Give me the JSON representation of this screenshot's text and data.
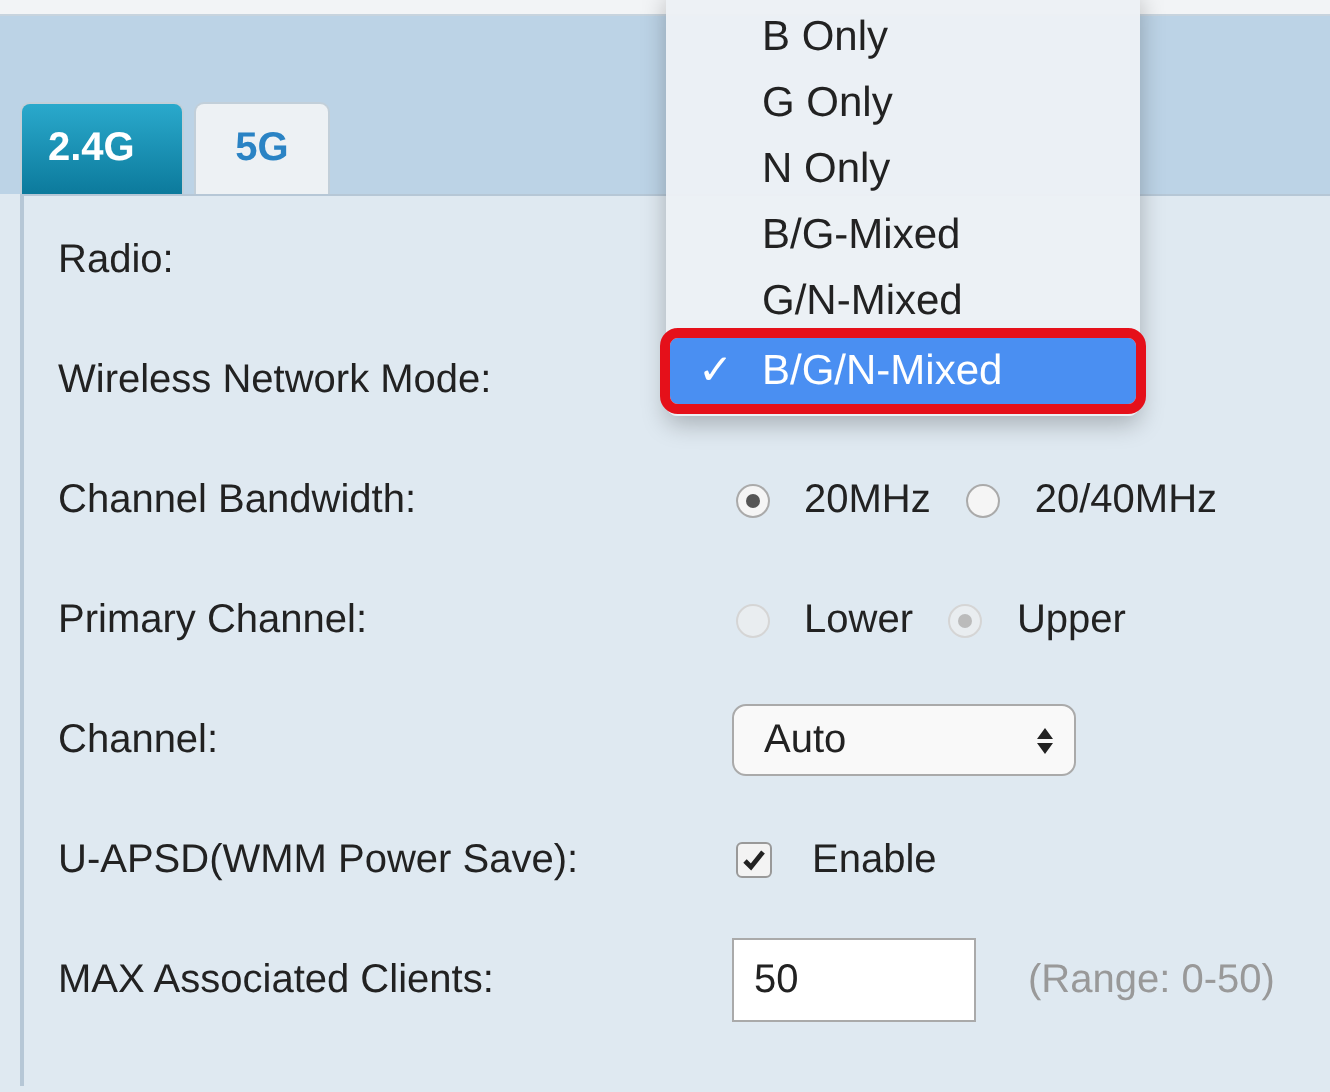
{
  "tabs": [
    {
      "label": "2.4G",
      "selected": true
    },
    {
      "label": "5G",
      "selected": false
    }
  ],
  "form": {
    "rows": [
      {
        "label": "Radio:",
        "kind": "label"
      },
      {
        "label": "Wireless Network Mode:",
        "kind": "label"
      },
      {
        "label": "Channel Bandwidth:",
        "kind": "radio",
        "disabled": false,
        "options": [
          {
            "label": "20MHz",
            "selected": true
          },
          {
            "label": "20/40MHz",
            "selected": false
          }
        ]
      },
      {
        "label": "Primary Channel:",
        "kind": "radio",
        "disabled": true,
        "options": [
          {
            "label": "Lower",
            "selected": false
          },
          {
            "label": "Upper",
            "selected": true
          }
        ]
      },
      {
        "label": "Channel:",
        "kind": "select",
        "value": "Auto"
      },
      {
        "label": "U-APSD(WMM Power Save):",
        "kind": "checkbox",
        "checked": true,
        "text": "Enable"
      },
      {
        "label": "MAX Associated Clients:",
        "kind": "input",
        "value": "50",
        "hint": "(Range: 0-50)"
      }
    ]
  },
  "dropdown": {
    "check": "✓",
    "items": [
      {
        "label": "B Only",
        "selected": false
      },
      {
        "label": "G Only",
        "selected": false
      },
      {
        "label": "N Only",
        "selected": false
      },
      {
        "label": "B/G-Mixed",
        "selected": false
      },
      {
        "label": "G/N-Mixed",
        "selected": false
      },
      {
        "label": "B/G/N-Mixed",
        "selected": true
      }
    ]
  }
}
